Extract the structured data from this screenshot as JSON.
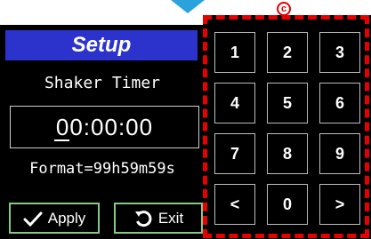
{
  "header": {
    "title": "Setup"
  },
  "timer": {
    "subtitle": "Shaker Timer",
    "value": "00:00:00",
    "format_hint": "Format=99h59m59s"
  },
  "buttons": {
    "apply_label": "Apply",
    "exit_label": "Exit"
  },
  "keypad": {
    "keys": [
      "1",
      "2",
      "3",
      "4",
      "5",
      "6",
      "7",
      "8",
      "9",
      "<",
      "0",
      ">"
    ]
  },
  "annotation": {
    "badge": "c",
    "highlight_color": "#e60000"
  },
  "colors": {
    "title_bg": "#2c33cc",
    "button_border": "#86c986",
    "arrow": "#2aa3dc"
  }
}
